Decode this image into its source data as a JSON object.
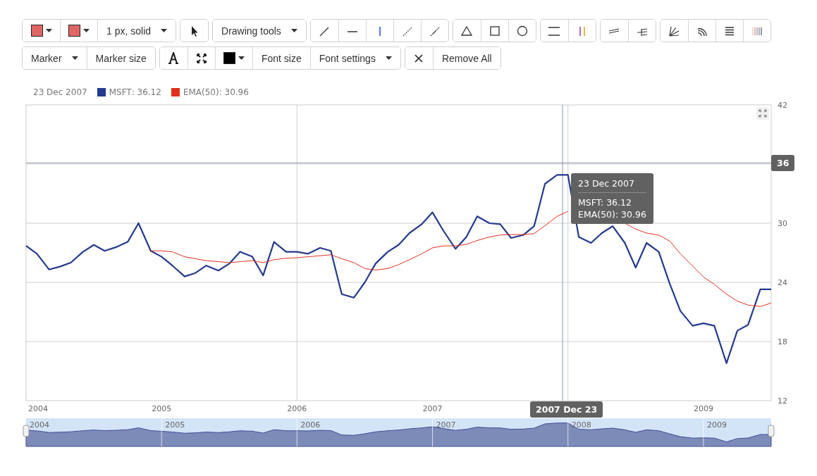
{
  "toolbar": {
    "rows": [
      {
        "groups": [
          {
            "items": [
              {
                "kind": "color",
                "color": "#e06666"
              },
              {
                "kind": "color",
                "color": "#e06666"
              },
              {
                "kind": "select",
                "label": "1 px, solid"
              }
            ]
          },
          {
            "items": [
              {
                "kind": "icon"
              }
            ]
          },
          {
            "items": [
              {
                "kind": "select",
                "label": "Drawing tools"
              }
            ]
          },
          {
            "items": [
              {
                "kind": "icon"
              },
              {
                "kind": "icon"
              },
              {
                "kind": "icon"
              },
              {
                "kind": "icon"
              },
              {
                "kind": "icon"
              }
            ]
          },
          {
            "items": [
              {
                "kind": "icon"
              },
              {
                "kind": "icon"
              },
              {
                "kind": "icon"
              }
            ]
          },
          {
            "items": [
              {
                "kind": "icon"
              },
              {
                "kind": "icon"
              }
            ]
          },
          {
            "items": [
              {
                "kind": "icon"
              },
              {
                "kind": "icon"
              }
            ]
          },
          {
            "items": [
              {
                "kind": "icon"
              },
              {
                "kind": "icon"
              },
              {
                "kind": "icon"
              },
              {
                "kind": "icon"
              }
            ]
          }
        ]
      },
      {
        "groups": [
          {
            "items": [
              {
                "kind": "select",
                "label": "Marker"
              },
              {
                "kind": "text",
                "label": "Marker size"
              }
            ]
          },
          {
            "items": [
              {
                "kind": "icon"
              },
              {
                "kind": "icon"
              },
              {
                "kind": "color",
                "color": "#000000"
              },
              {
                "kind": "text",
                "label": "Font size"
              },
              {
                "kind": "select",
                "label": "Font settings"
              }
            ]
          },
          {
            "items": [
              {
                "kind": "icon"
              },
              {
                "kind": "text",
                "label": "Remove All"
              }
            ]
          }
        ]
      }
    ]
  },
  "legend": {
    "date": "23 Dec 2007",
    "entries": [
      {
        "value": ": 36.12"
      },
      {
        "value": ": 30.96"
      }
    ]
  },
  "chart": {
    "chart_data": {
      "type": "line",
      "grid": true,
      "xlim": [
        2004,
        2009.5
      ],
      "ylim": [
        12,
        42
      ],
      "yticks": [
        12,
        18,
        24,
        30,
        42
      ],
      "xticks": [
        {
          "value": 2004,
          "label": "2004"
        },
        {
          "value": 2005,
          "label": "2005"
        },
        {
          "value": 2006,
          "label": "2006"
        },
        {
          "value": 2007,
          "label": "2007"
        },
        {
          "value": 2009,
          "label": "2009"
        }
      ],
      "x": [
        2004.0,
        2004.08,
        2004.17,
        2004.25,
        2004.33,
        2004.42,
        2004.5,
        2004.58,
        2004.67,
        2004.75,
        2004.83,
        2004.92,
        2005.0,
        2005.08,
        2005.17,
        2005.25,
        2005.33,
        2005.42,
        2005.5,
        2005.58,
        2005.67,
        2005.75,
        2005.83,
        2005.92,
        2006.0,
        2006.08,
        2006.17,
        2006.25,
        2006.33,
        2006.42,
        2006.5,
        2006.58,
        2006.67,
        2006.75,
        2006.83,
        2006.92,
        2007.0,
        2007.08,
        2007.17,
        2007.25,
        2007.33,
        2007.42,
        2007.5,
        2007.58,
        2007.67,
        2007.75,
        2007.83,
        2007.92,
        2008.0,
        2008.08,
        2008.17,
        2008.25,
        2008.33,
        2008.42,
        2008.5,
        2008.58,
        2008.67,
        2008.75,
        2008.83,
        2008.92,
        2009.0,
        2009.08,
        2009.17,
        2009.25,
        2009.33,
        2009.42,
        2009.5
      ],
      "series": [
        {
          "name": "MSFT",
          "color": "#233a8f",
          "values": [
            27.7,
            26.9,
            25.3,
            25.6,
            26,
            27.1,
            27.8,
            27.2,
            27.6,
            28.1,
            30,
            27.2,
            26.6,
            25.7,
            24.6,
            24.95,
            25.7,
            25.2,
            25.9,
            27.1,
            26.6,
            24.7,
            28.1,
            27.1,
            27.1,
            26.9,
            27.5,
            27.2,
            22.8,
            22.45,
            24,
            25.9,
            27.1,
            27.8,
            29,
            29.9,
            31.1,
            29.25,
            27.4,
            28.6,
            30.7,
            30,
            29.9,
            28.5,
            28.8,
            29.7,
            34,
            34.9,
            34.9,
            28.6,
            28,
            29,
            29.7,
            28,
            25.5,
            28,
            27.1,
            23.9,
            21.1,
            19.6,
            19.85,
            19.6,
            15.8,
            19.1,
            19.7,
            23.3,
            23.3
          ]
        },
        {
          "name": "EMA(50)",
          "color": "#e0301e",
          "values": [
            null,
            null,
            null,
            null,
            null,
            null,
            null,
            null,
            null,
            null,
            null,
            27.2,
            27.2,
            27.1,
            26.6,
            26.4,
            26.2,
            26.1,
            26,
            26.1,
            26.2,
            26,
            26.3,
            26.45,
            26.5,
            26.6,
            26.7,
            26.8,
            26.4,
            26,
            25.4,
            25.25,
            25.4,
            25.8,
            26.3,
            26.9,
            27.5,
            27.7,
            27.7,
            27.85,
            28.25,
            28.6,
            28.8,
            28.85,
            28.85,
            28.95,
            29.75,
            30.7,
            31.2,
            null,
            null,
            null,
            null,
            30,
            29.4,
            29,
            28.8,
            28.2,
            26.9,
            25.65,
            24.55,
            23.8,
            22.8,
            22.1,
            21.7,
            21.55,
            21.9
          ]
        }
      ],
      "ref_lines": [
        {
          "axis": "y",
          "value": 36.12,
          "label": "36"
        },
        {
          "axis": "x",
          "value": 2007.96,
          "label": "2007 Dec 23"
        }
      ]
    },
    "tooltip": {
      "title": "23 Dec 2007",
      "lines": [
        "MSFT: 36.12",
        "EMA(50): 30.96"
      ]
    }
  },
  "navigator": {
    "year_labels": [
      "2004",
      "2005",
      "2006",
      "2007",
      "2008",
      "2009"
    ]
  }
}
